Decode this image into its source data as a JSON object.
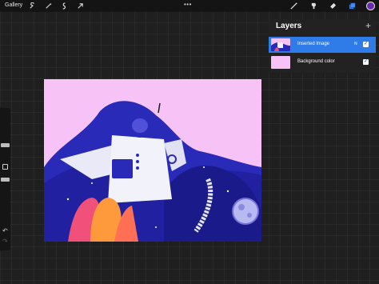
{
  "topbar": {
    "gallery_label": "Gallery",
    "left_tools": [
      "wrench-icon",
      "magic-wand-icon",
      "selection-icon",
      "transform-arrow-icon"
    ],
    "center_menu": "•••",
    "right_tools": [
      "brush-icon",
      "smudge-icon",
      "eraser-icon",
      "layers-icon"
    ],
    "current_color": "#6a2bb0"
  },
  "sidebar": {
    "undo_icon": "↶",
    "redo_icon": "↷"
  },
  "layers_panel": {
    "title": "Layers",
    "add_icon": "+",
    "layers": [
      {
        "name": "Inserted Image",
        "blend_mode": "N",
        "visible": true,
        "selected": true
      },
      {
        "name": "Background color",
        "blend_mode": "",
        "visible": true,
        "selected": false
      }
    ]
  },
  "colors": {
    "accent": "#2f7be8",
    "canvas_background": "#f7c3f7",
    "illustration_blue": "#2a2ab8"
  }
}
